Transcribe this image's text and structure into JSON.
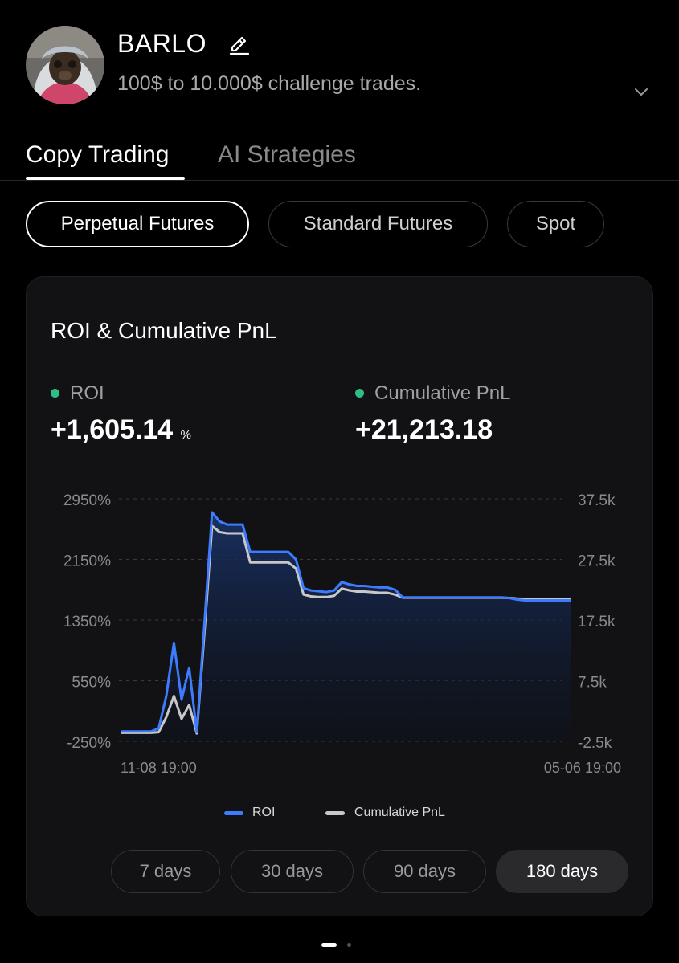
{
  "profile": {
    "name": "BARLO",
    "bio": "100$ to 10.000$ challenge trades."
  },
  "tabs": [
    {
      "label": "Copy Trading",
      "active": true
    },
    {
      "label": "AI Strategies",
      "active": false
    }
  ],
  "market_types": [
    {
      "label": "Perpetual Futures",
      "active": true
    },
    {
      "label": "Standard Futures",
      "active": false
    },
    {
      "label": "Spot",
      "active": false
    }
  ],
  "card": {
    "title": "ROI & Cumulative PnL",
    "roi_label": "ROI",
    "roi_value": "+1,605.14",
    "roi_unit": "%",
    "pnl_label": "Cumulative PnL",
    "pnl_value": "+21,213.18"
  },
  "chart_data": {
    "type": "line",
    "title": "ROI & Cumulative PnL",
    "x_start_label": "11-08 19:00",
    "x_end_label": "05-06 19:00",
    "left_axis": {
      "ticks": [
        "2950%",
        "2150%",
        "1350%",
        "550%",
        "-250%"
      ],
      "range": [
        -250,
        2950
      ]
    },
    "right_axis": {
      "ticks": [
        "37.5k",
        "27.5k",
        "17.5k",
        "7.5k",
        "-2.5k"
      ],
      "range": [
        -2500,
        37500
      ]
    },
    "grid": true,
    "legend_position": "bottom",
    "series": [
      {
        "name": "ROI",
        "axis": "left",
        "color": "#3d7bff",
        "values": [
          -120,
          -120,
          -120,
          -120,
          -120,
          -80,
          350,
          1050,
          300,
          720,
          -130,
          1300,
          2770,
          2650,
          2610,
          2610,
          2610,
          2250,
          2250,
          2250,
          2250,
          2250,
          2250,
          2150,
          1770,
          1740,
          1730,
          1720,
          1740,
          1850,
          1820,
          1800,
          1800,
          1790,
          1780,
          1780,
          1750,
          1650,
          1650,
          1650,
          1650,
          1650,
          1650,
          1650,
          1650,
          1650,
          1650,
          1650,
          1650,
          1650,
          1650,
          1640,
          1620,
          1610,
          1610,
          1610,
          1610,
          1610,
          1610,
          1610
        ]
      },
      {
        "name": "Cumulative PnL",
        "axis": "right",
        "color": "#c8c8c8",
        "values": [
          -1100,
          -1100,
          -1100,
          -1100,
          -1100,
          -1000,
          1500,
          5000,
          1200,
          3500,
          -1200,
          15500,
          33000,
          32000,
          31800,
          31800,
          31800,
          27000,
          27000,
          27000,
          27000,
          27000,
          27000,
          26000,
          21700,
          21400,
          21300,
          21300,
          21500,
          22700,
          22400,
          22200,
          22200,
          22100,
          22000,
          22000,
          21700,
          21200,
          21200,
          21200,
          21200,
          21200,
          21200,
          21200,
          21200,
          21200,
          21200,
          21200,
          21200,
          21200,
          21200,
          21150,
          21050,
          21000,
          21000,
          21000,
          21000,
          21000,
          21000,
          21000
        ]
      }
    ]
  },
  "legend": [
    {
      "label": "ROI",
      "color": "#3d7bff"
    },
    {
      "label": "Cumulative PnL",
      "color": "#c8c8c8"
    }
  ],
  "ranges": [
    {
      "label": "7 days",
      "active": false
    },
    {
      "label": "30 days",
      "active": false
    },
    {
      "label": "90 days",
      "active": false
    },
    {
      "label": "180 days",
      "active": true
    }
  ],
  "icons": {
    "edit": "pencil-icon",
    "expand": "chevron-down-icon"
  },
  "colors": {
    "accent_green": "#2ebd85",
    "roi_blue": "#3d7bff",
    "pnl_gray": "#c8c8c8"
  }
}
